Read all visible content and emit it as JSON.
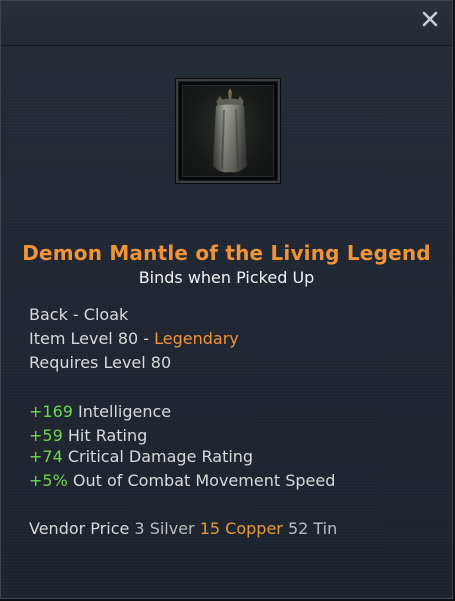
{
  "item": {
    "name": "Demon Mantle of the Living Legend",
    "binds": "Binds when Picked Up",
    "slot": "Back - Cloak",
    "item_level_label": "Item Level 80 - ",
    "rarity": "Legendary",
    "requires": "Requires Level 80",
    "icon": "cloak-icon"
  },
  "stats": [
    {
      "value": "+169",
      "label": " Intelligence"
    },
    {
      "value": "+59",
      "label": " Hit Rating"
    },
    {
      "value": "+74",
      "label": " Critical Damage Rating"
    },
    {
      "value": "+5%",
      "label": " Out of Combat Movement Speed"
    }
  ],
  "vendor": {
    "label": "Vendor Price ",
    "silver": "3 Silver ",
    "copper": "15 Copper ",
    "tin": "52 Tin"
  },
  "colors": {
    "legendary": "#f0943a",
    "stat_green": "#6fd653",
    "copper": "#e49a3e"
  }
}
